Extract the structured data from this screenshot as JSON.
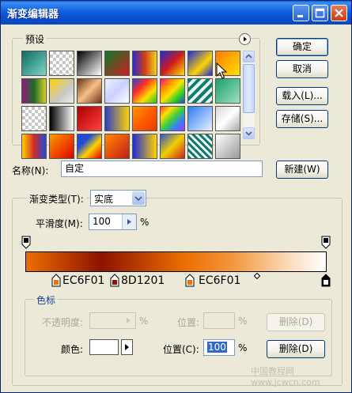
{
  "window": {
    "title": "渐变编辑器"
  },
  "presets": {
    "label": "预设",
    "swatches": [
      "linear-gradient(135deg,#0c6b63,#7ed6c6)",
      "repeating-conic-gradient(#c7c7c7 0 25%,#fff 0 50%) 0 0/8px 8px",
      "linear-gradient(135deg,#000,#fff)",
      "linear-gradient(135deg,#0a7a2a,#d21e1e)",
      "linear-gradient(90deg,#2b2bd0,#d03c16,#f1d21e)",
      "linear-gradient(135deg,#1e2bd6,#cf1b1b,#ffe100)",
      "linear-gradient(135deg,#1b2be0,#ffd200 60%,#1b2be0)",
      "linear-gradient(135deg,#ff7a00,#ffe100)",
      "linear-gradient(90deg,#8f1a7a,#1f6b2b,#d8d020)",
      "linear-gradient(135deg,#ffd200,#c8c8c8 60%,#eee)",
      "linear-gradient(135deg,#6b3412,#f6c08a,#6b3412)",
      "linear-gradient(135deg,#eef0ff,#c9d1ff,#fff)",
      "linear-gradient(135deg,#1f4bd8,#ff2a2a,#ffde00,#23c22a)",
      "linear-gradient(135deg,#ff00aa,#ff8800,#ffe100,#2ad02a,#1f4bd8)",
      "repeating-linear-gradient(135deg,#0d7d6d 0 4px,#e9f6f4 4px 8px)",
      "linear-gradient(135deg,#1aa06a,#9fe0c2)",
      "repeating-conic-gradient(#c7c7c7 0 25%,#fff 0 50%) 0 0/8px 8px",
      "linear-gradient(90deg,#000,#fff)",
      "linear-gradient(135deg,#aa0000,#ff4040)",
      "linear-gradient(90deg,#2b3ec7,#ffd200)",
      "linear-gradient(135deg,#ff9a00,#ff5c00,#e63c00)",
      "linear-gradient(135deg,#ff3a3a,#ffe100,#3ad03a,#3a7cff,#a03aff)",
      "linear-gradient(135deg,#2a7cf0,#e9f2ff)",
      "linear-gradient(135deg,#d8d8d8,#fff,#a8a8a8)",
      "linear-gradient(90deg,#ffd200,#d22a2a,#1f4bd8)",
      "linear-gradient(135deg,#ff9a00,#e00000)",
      "linear-gradient(135deg,#1f4bd8,#1f4bd8 30%,#ffd200 60%,#e00000)",
      "linear-gradient(135deg,#ff8800,#c51b1b)",
      "linear-gradient(90deg,#1f2bd8,#ffd200)",
      "linear-gradient(135deg,#3050d0,#f0d000,#d02020)",
      "repeating-linear-gradient(45deg,#0d7d6d 0 3px,#ffffff 3px 6px)",
      "linear-gradient(135deg,#ffffff,#999999)"
    ],
    "menu_icon": "triangle-right-icon"
  },
  "buttons": {
    "ok": "确定",
    "cancel": "取消",
    "load": "载入(L)...",
    "save": "存储(S)...",
    "new": "新建(W)",
    "delete_opacity": "删除(D)",
    "delete_color": "删除(D)"
  },
  "name": {
    "label": "名称(N):",
    "value": "自定"
  },
  "gradient_type": {
    "label": "渐变类型(T):",
    "value": "实底"
  },
  "smoothness": {
    "label": "平滑度(M):",
    "value": "100",
    "unit": "%"
  },
  "gradient_bar": {
    "stops": [
      {
        "label": "EC6F01",
        "color": "#EC6F01"
      },
      {
        "label": "8D1201",
        "color": "#8D1201"
      },
      {
        "label": "EC6F01",
        "color": "#EC6F01"
      }
    ]
  },
  "stops_group": {
    "label": "色标",
    "opacity_label": "不透明度:",
    "opacity_unit": "%",
    "opacity_location_label": "位置:",
    "opacity_location_unit": "%",
    "color_label": "颜色:",
    "color_location_label": "位置(C):",
    "color_location_value": "100",
    "color_location_unit": "%"
  },
  "watermark": "中国教程网 www.jcwcn.com"
}
